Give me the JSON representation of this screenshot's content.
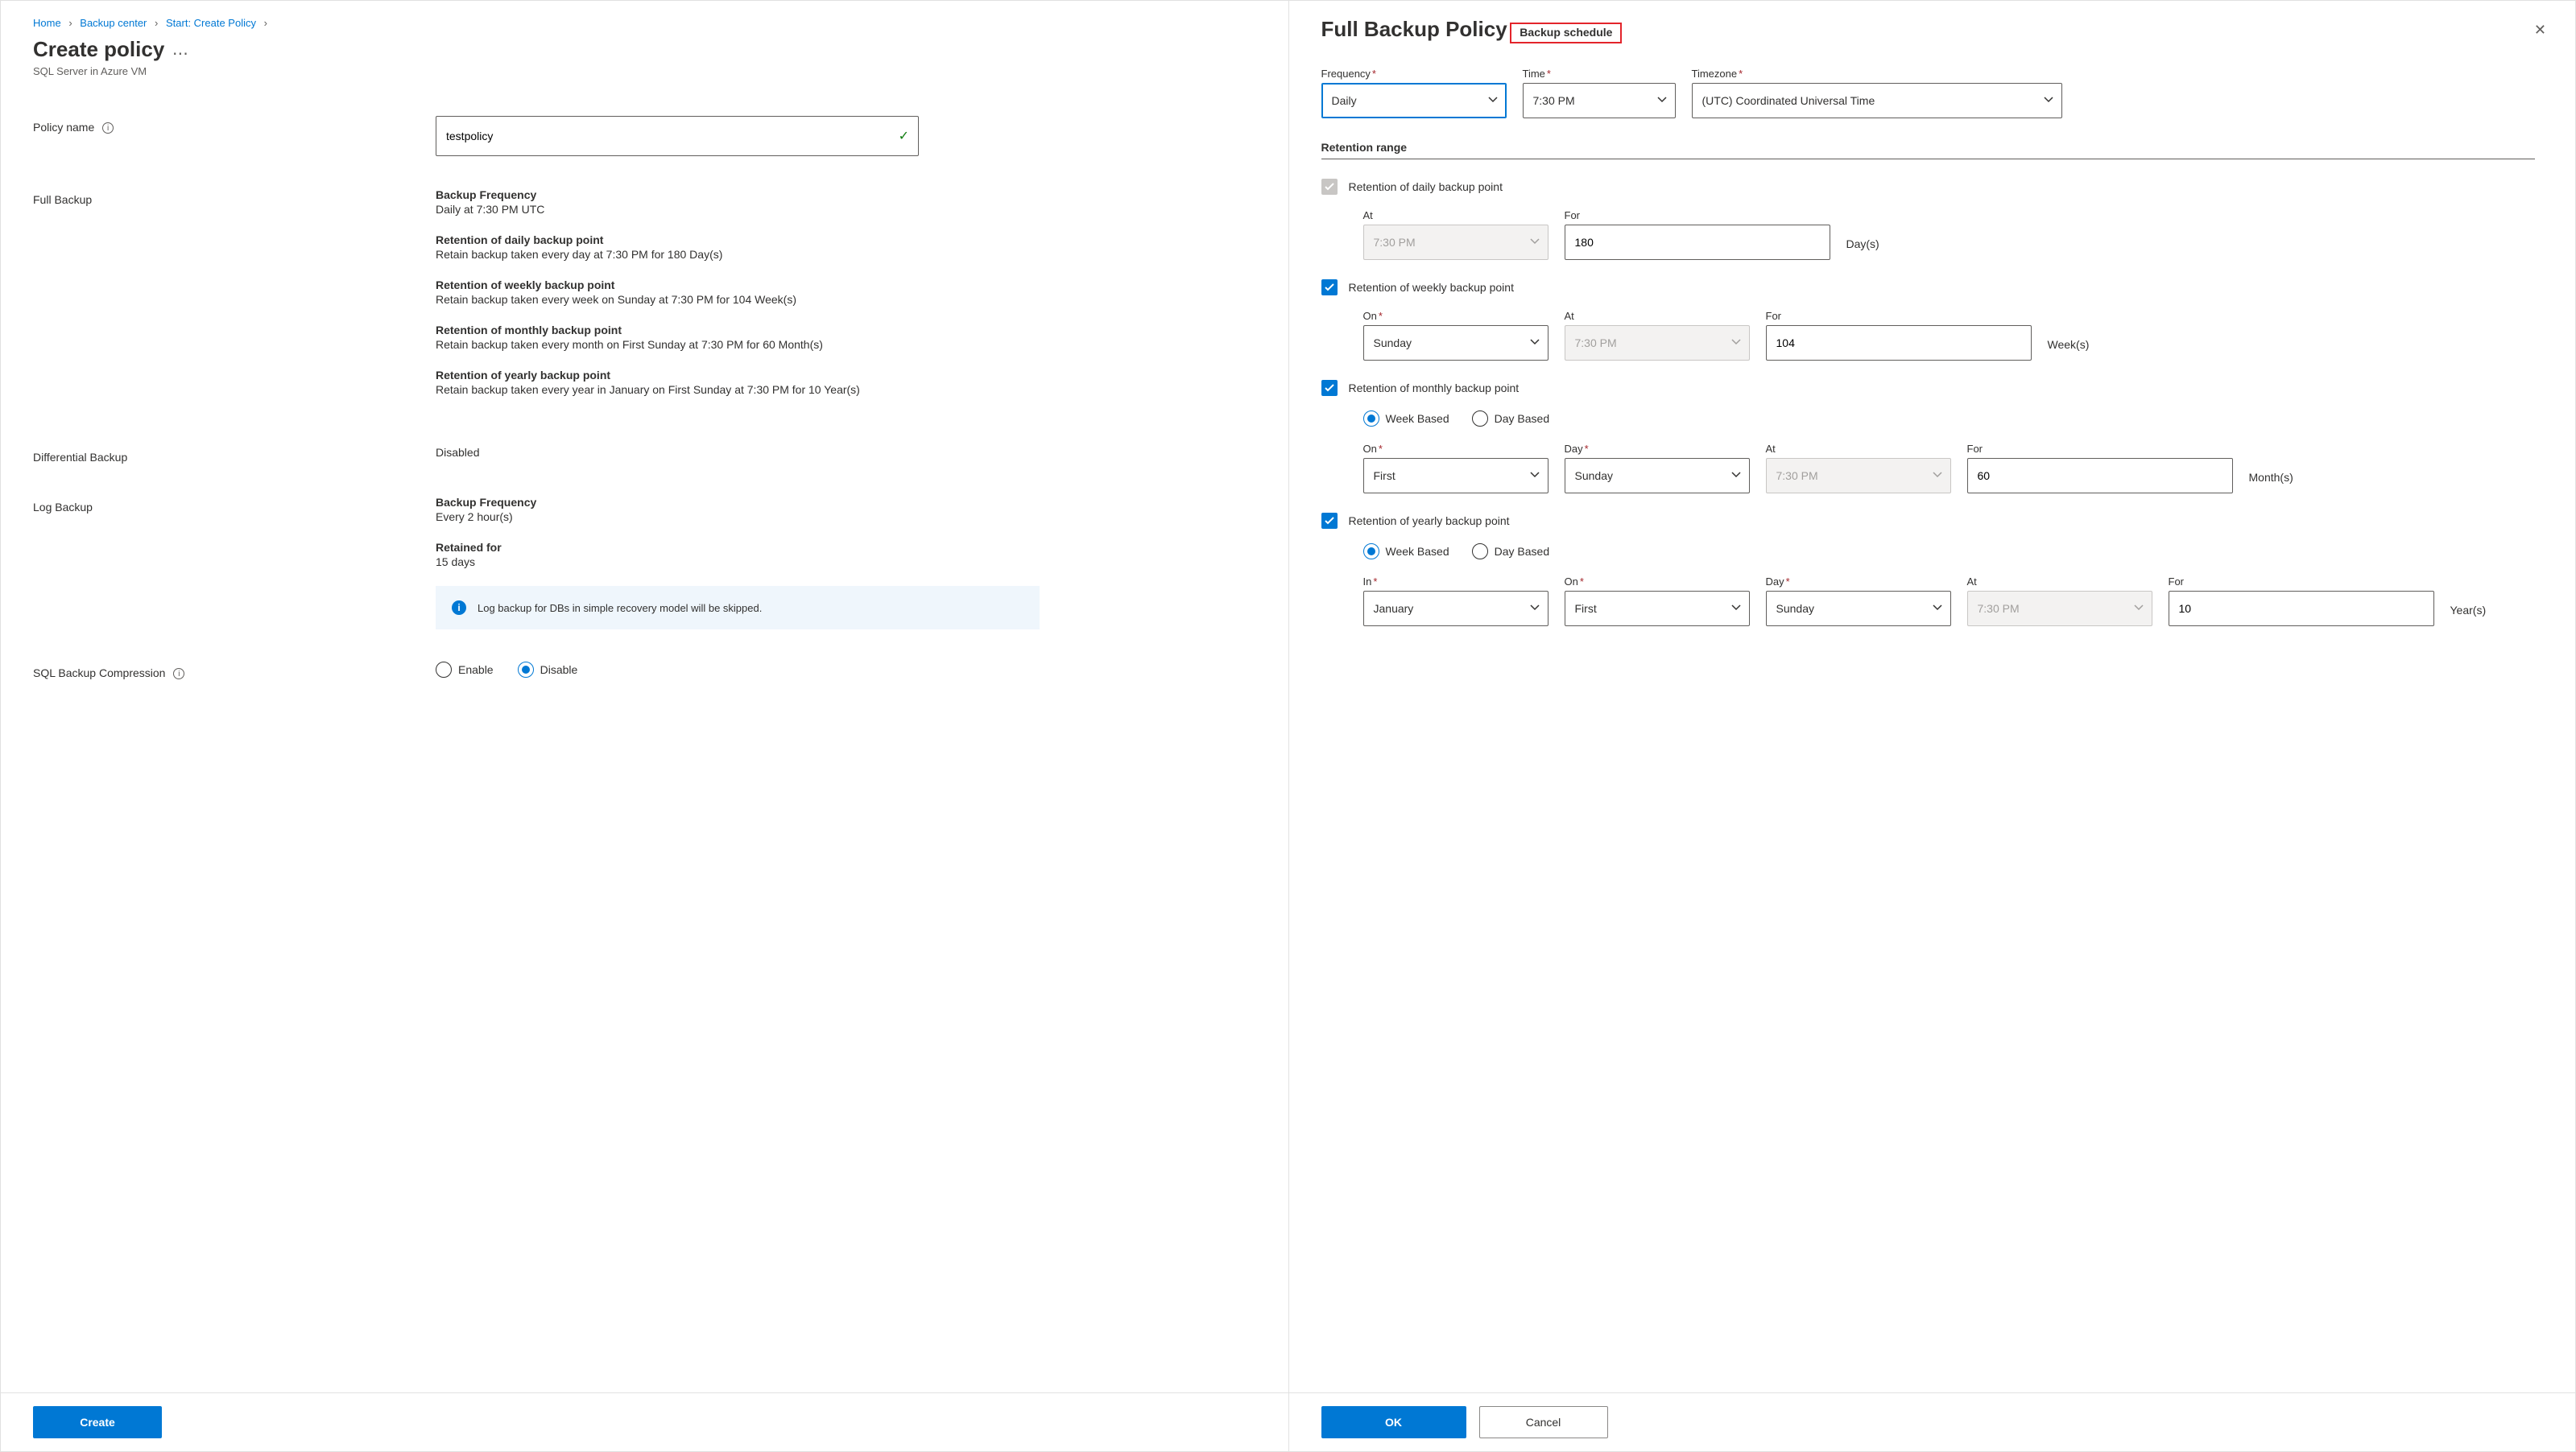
{
  "breadcrumb": {
    "home": "Home",
    "center": "Backup center",
    "start": "Start: Create Policy"
  },
  "left": {
    "title": "Create policy",
    "subtitle": "SQL Server in Azure VM",
    "policy_name_label": "Policy name",
    "policy_name_value": "testpolicy",
    "full_backup_label": "Full Backup",
    "full": {
      "freq_h": "Backup Frequency",
      "freq_v": "Daily at 7:30 PM UTC",
      "daily_h": "Retention of daily backup point",
      "daily_v": "Retain backup taken every day at 7:30 PM for 180 Day(s)",
      "weekly_h": "Retention of weekly backup point",
      "weekly_v": "Retain backup taken every week on Sunday at 7:30 PM for 104 Week(s)",
      "monthly_h": "Retention of monthly backup point",
      "monthly_v": "Retain backup taken every month on First Sunday at 7:30 PM for 60 Month(s)",
      "yearly_h": "Retention of yearly backup point",
      "yearly_v": "Retain backup taken every year in January on First Sunday at 7:30 PM for 10 Year(s)"
    },
    "diff_label": "Differential Backup",
    "diff_value": "Disabled",
    "log_label": "Log Backup",
    "log_freq_h": "Backup Frequency",
    "log_freq_v": "Every 2 hour(s)",
    "log_ret_h": "Retained for",
    "log_ret_v": "15 days",
    "info_banner": "Log backup for DBs in simple recovery model will be skipped.",
    "comp_label": "SQL Backup Compression",
    "enable": "Enable",
    "disable": "Disable",
    "create_btn": "Create"
  },
  "right": {
    "title": "Full Backup Policy",
    "sched_title": "Backup schedule",
    "freq_label": "Frequency",
    "freq_value": "Daily",
    "time_label": "Time",
    "time_value": "7:30 PM",
    "tz_label": "Timezone",
    "tz_value": "(UTC) Coordinated Universal Time",
    "ret_title": "Retention range",
    "daily": {
      "label": "Retention of daily backup point",
      "at_label": "At",
      "at_value": "7:30 PM",
      "for_label": "For",
      "for_value": "180",
      "unit": "Day(s)"
    },
    "weekly": {
      "label": "Retention of weekly backup point",
      "on_label": "On",
      "on_value": "Sunday",
      "at_label": "At",
      "at_value": "7:30 PM",
      "for_label": "For",
      "for_value": "104",
      "unit": "Week(s)"
    },
    "monthly": {
      "label": "Retention of monthly backup point",
      "week_based": "Week Based",
      "day_based": "Day Based",
      "on_label": "On",
      "on_value": "First",
      "day_label": "Day",
      "day_value": "Sunday",
      "at_label": "At",
      "at_value": "7:30 PM",
      "for_label": "For",
      "for_value": "60",
      "unit": "Month(s)"
    },
    "yearly": {
      "label": "Retention of yearly backup point",
      "week_based": "Week Based",
      "day_based": "Day Based",
      "in_label": "In",
      "in_value": "January",
      "on_label": "On",
      "on_value": "First",
      "day_label": "Day",
      "day_value": "Sunday",
      "at_label": "At",
      "at_value": "7:30 PM",
      "for_label": "For",
      "for_value": "10",
      "unit": "Year(s)"
    },
    "ok_btn": "OK",
    "cancel_btn": "Cancel"
  }
}
